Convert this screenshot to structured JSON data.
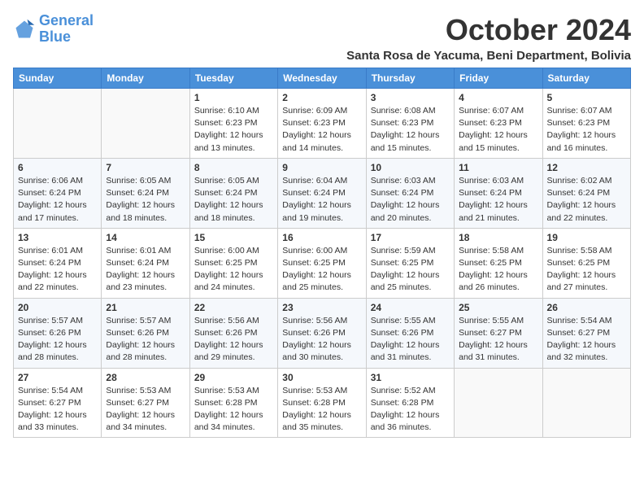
{
  "logo": {
    "line1": "General",
    "line2": "Blue"
  },
  "title": "October 2024",
  "location": "Santa Rosa de Yacuma, Beni Department, Bolivia",
  "days_of_week": [
    "Sunday",
    "Monday",
    "Tuesday",
    "Wednesday",
    "Thursday",
    "Friday",
    "Saturday"
  ],
  "weeks": [
    [
      {
        "day": "",
        "info": ""
      },
      {
        "day": "",
        "info": ""
      },
      {
        "day": "1",
        "info": "Sunrise: 6:10 AM\nSunset: 6:23 PM\nDaylight: 12 hours and 13 minutes."
      },
      {
        "day": "2",
        "info": "Sunrise: 6:09 AM\nSunset: 6:23 PM\nDaylight: 12 hours and 14 minutes."
      },
      {
        "day": "3",
        "info": "Sunrise: 6:08 AM\nSunset: 6:23 PM\nDaylight: 12 hours and 15 minutes."
      },
      {
        "day": "4",
        "info": "Sunrise: 6:07 AM\nSunset: 6:23 PM\nDaylight: 12 hours and 15 minutes."
      },
      {
        "day": "5",
        "info": "Sunrise: 6:07 AM\nSunset: 6:23 PM\nDaylight: 12 hours and 16 minutes."
      }
    ],
    [
      {
        "day": "6",
        "info": "Sunrise: 6:06 AM\nSunset: 6:24 PM\nDaylight: 12 hours and 17 minutes."
      },
      {
        "day": "7",
        "info": "Sunrise: 6:05 AM\nSunset: 6:24 PM\nDaylight: 12 hours and 18 minutes."
      },
      {
        "day": "8",
        "info": "Sunrise: 6:05 AM\nSunset: 6:24 PM\nDaylight: 12 hours and 18 minutes."
      },
      {
        "day": "9",
        "info": "Sunrise: 6:04 AM\nSunset: 6:24 PM\nDaylight: 12 hours and 19 minutes."
      },
      {
        "day": "10",
        "info": "Sunrise: 6:03 AM\nSunset: 6:24 PM\nDaylight: 12 hours and 20 minutes."
      },
      {
        "day": "11",
        "info": "Sunrise: 6:03 AM\nSunset: 6:24 PM\nDaylight: 12 hours and 21 minutes."
      },
      {
        "day": "12",
        "info": "Sunrise: 6:02 AM\nSunset: 6:24 PM\nDaylight: 12 hours and 22 minutes."
      }
    ],
    [
      {
        "day": "13",
        "info": "Sunrise: 6:01 AM\nSunset: 6:24 PM\nDaylight: 12 hours and 22 minutes."
      },
      {
        "day": "14",
        "info": "Sunrise: 6:01 AM\nSunset: 6:24 PM\nDaylight: 12 hours and 23 minutes."
      },
      {
        "day": "15",
        "info": "Sunrise: 6:00 AM\nSunset: 6:25 PM\nDaylight: 12 hours and 24 minutes."
      },
      {
        "day": "16",
        "info": "Sunrise: 6:00 AM\nSunset: 6:25 PM\nDaylight: 12 hours and 25 minutes."
      },
      {
        "day": "17",
        "info": "Sunrise: 5:59 AM\nSunset: 6:25 PM\nDaylight: 12 hours and 25 minutes."
      },
      {
        "day": "18",
        "info": "Sunrise: 5:58 AM\nSunset: 6:25 PM\nDaylight: 12 hours and 26 minutes."
      },
      {
        "day": "19",
        "info": "Sunrise: 5:58 AM\nSunset: 6:25 PM\nDaylight: 12 hours and 27 minutes."
      }
    ],
    [
      {
        "day": "20",
        "info": "Sunrise: 5:57 AM\nSunset: 6:26 PM\nDaylight: 12 hours and 28 minutes."
      },
      {
        "day": "21",
        "info": "Sunrise: 5:57 AM\nSunset: 6:26 PM\nDaylight: 12 hours and 28 minutes."
      },
      {
        "day": "22",
        "info": "Sunrise: 5:56 AM\nSunset: 6:26 PM\nDaylight: 12 hours and 29 minutes."
      },
      {
        "day": "23",
        "info": "Sunrise: 5:56 AM\nSunset: 6:26 PM\nDaylight: 12 hours and 30 minutes."
      },
      {
        "day": "24",
        "info": "Sunrise: 5:55 AM\nSunset: 6:26 PM\nDaylight: 12 hours and 31 minutes."
      },
      {
        "day": "25",
        "info": "Sunrise: 5:55 AM\nSunset: 6:27 PM\nDaylight: 12 hours and 31 minutes."
      },
      {
        "day": "26",
        "info": "Sunrise: 5:54 AM\nSunset: 6:27 PM\nDaylight: 12 hours and 32 minutes."
      }
    ],
    [
      {
        "day": "27",
        "info": "Sunrise: 5:54 AM\nSunset: 6:27 PM\nDaylight: 12 hours and 33 minutes."
      },
      {
        "day": "28",
        "info": "Sunrise: 5:53 AM\nSunset: 6:27 PM\nDaylight: 12 hours and 34 minutes."
      },
      {
        "day": "29",
        "info": "Sunrise: 5:53 AM\nSunset: 6:28 PM\nDaylight: 12 hours and 34 minutes."
      },
      {
        "day": "30",
        "info": "Sunrise: 5:53 AM\nSunset: 6:28 PM\nDaylight: 12 hours and 35 minutes."
      },
      {
        "day": "31",
        "info": "Sunrise: 5:52 AM\nSunset: 6:28 PM\nDaylight: 12 hours and 36 minutes."
      },
      {
        "day": "",
        "info": ""
      },
      {
        "day": "",
        "info": ""
      }
    ]
  ]
}
